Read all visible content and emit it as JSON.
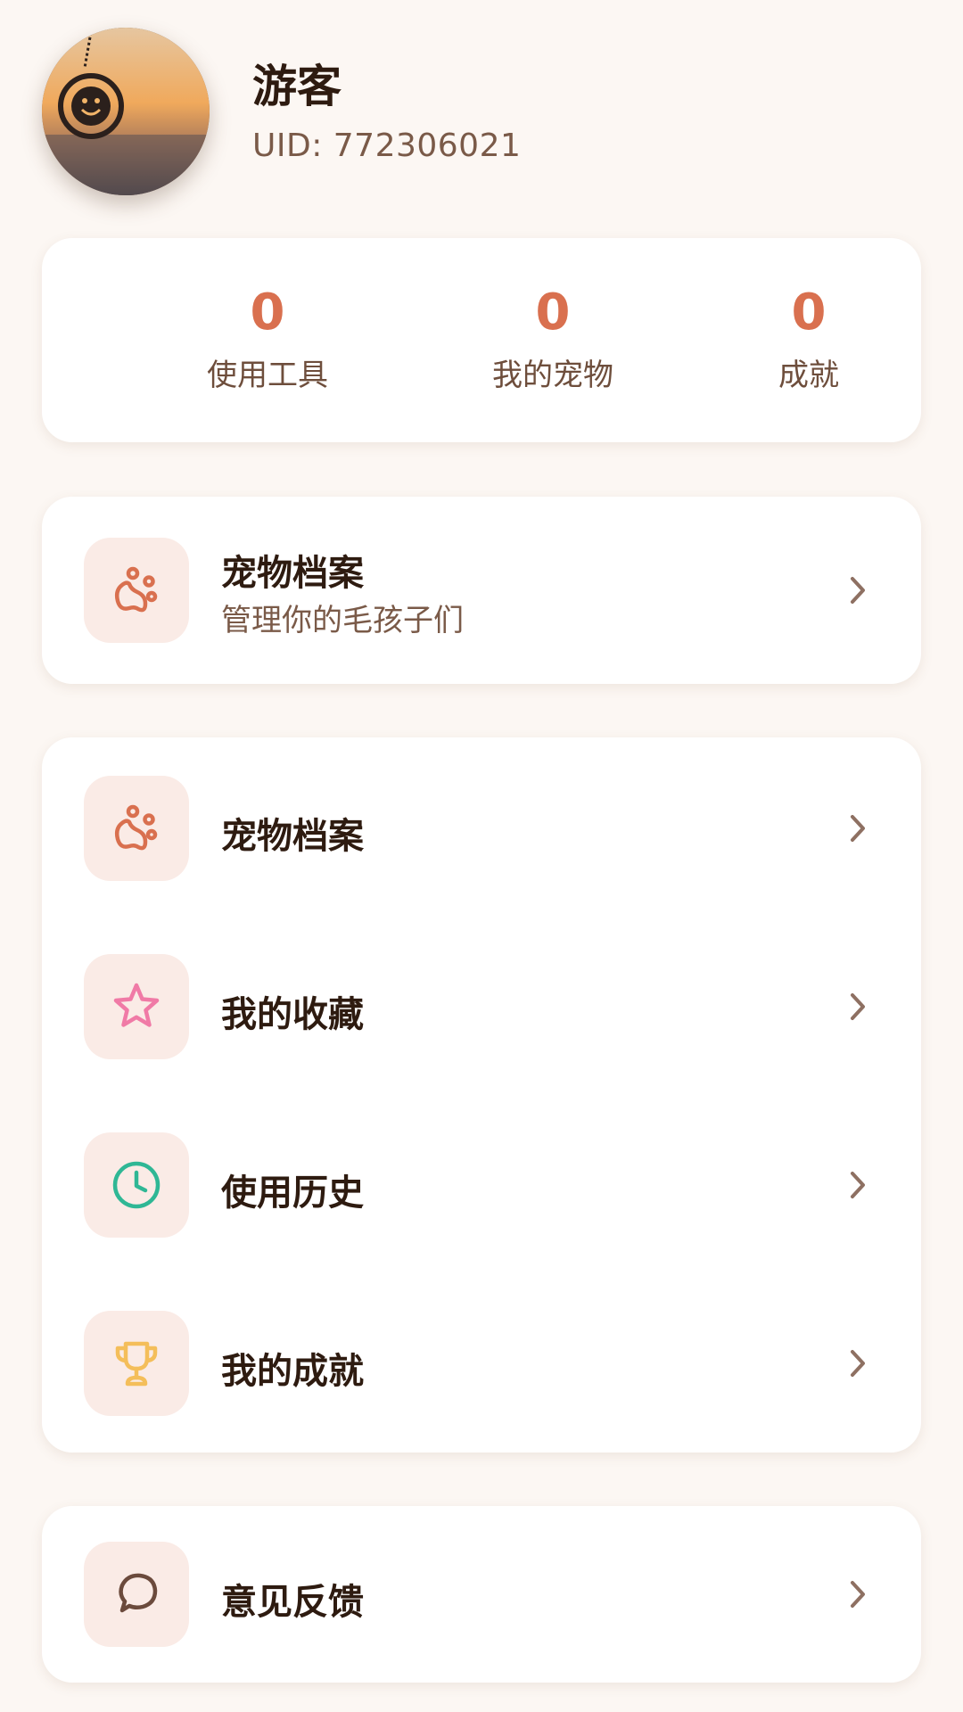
{
  "profile": {
    "name": "游客",
    "uid": "UID: 772306021"
  },
  "stats": [
    {
      "value": "0",
      "label": "使用工具"
    },
    {
      "value": "0",
      "label": "我的宠物"
    },
    {
      "value": "0",
      "label": "成就"
    }
  ],
  "featured": {
    "title": "宠物档案",
    "subtitle": "管理你的毛孩子们",
    "icon": "paw-icon"
  },
  "menu": [
    {
      "label": "宠物档案",
      "icon": "paw-icon"
    },
    {
      "label": "我的收藏",
      "icon": "star-icon"
    },
    {
      "label": "使用历史",
      "icon": "clock-icon"
    },
    {
      "label": "我的成就",
      "icon": "trophy-icon"
    }
  ],
  "feedback": {
    "label": "意见反馈",
    "icon": "chat-bubble-icon"
  },
  "colors": {
    "accent": "#d9704f",
    "background": "#fcf7f3",
    "icon_bg": "#faebe6",
    "star": "#f07aa6",
    "clock": "#2fb795",
    "trophy": "#f4be5a",
    "chat": "#6b4a3c"
  }
}
